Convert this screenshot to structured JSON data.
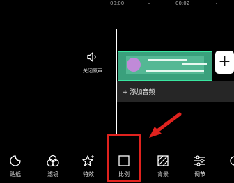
{
  "timeline": {
    "timecodes": [
      "00:00",
      "00:02"
    ],
    "mute_label": "关闭原声",
    "add_audio_label": "+ 添加音频",
    "add_clip_symbol": "+"
  },
  "toolbar": {
    "items": [
      {
        "label": "贴纸",
        "icon": "sticker-icon"
      },
      {
        "label": "滤镜",
        "icon": "filter-icon"
      },
      {
        "label": "特效",
        "icon": "effects-icon"
      },
      {
        "label": "比例",
        "icon": "ratio-icon"
      },
      {
        "label": "背景",
        "icon": "background-icon"
      },
      {
        "label": "调节",
        "icon": "adjust-icon"
      }
    ]
  },
  "colors": {
    "highlight": "#e0221e",
    "clip": "#3aa07c",
    "clip_border": "#39e6a0"
  }
}
